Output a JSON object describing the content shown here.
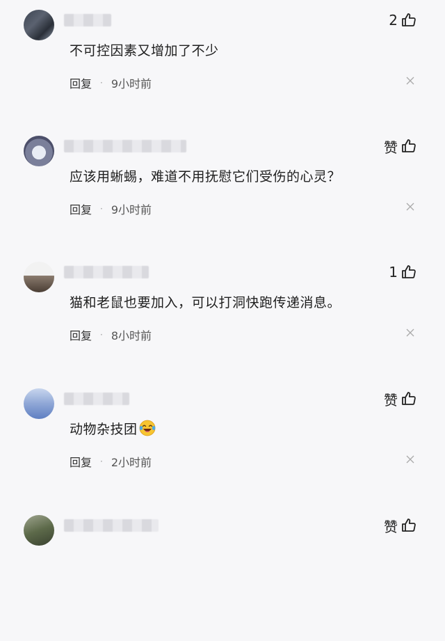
{
  "comments": [
    {
      "text": "不可控因素又增加了不少",
      "reply_label": "回复",
      "time": "9小时前",
      "like_label": "2"
    },
    {
      "text": "应该用蜥蜴，难道不用抚慰它们受伤的心灵？",
      "reply_label": "回复",
      "time": "9小时前",
      "like_label": "赞"
    },
    {
      "text": "猫和老鼠也要加入，可以打洞快跑传递消息。",
      "reply_label": "回复",
      "time": "8小时前",
      "like_label": "1"
    },
    {
      "text": "动物杂技团",
      "reply_label": "回复",
      "time": "2小时前",
      "like_label": "赞",
      "emoji": "laughing-crying-emoji"
    },
    {
      "like_label": "赞"
    }
  ],
  "separator": "·",
  "icons": {
    "like": "thumbs-up-icon",
    "close": "close-icon"
  },
  "colors": {
    "background": "#f7f7f9",
    "text": "#1e1e1e",
    "meta": "#555555"
  }
}
